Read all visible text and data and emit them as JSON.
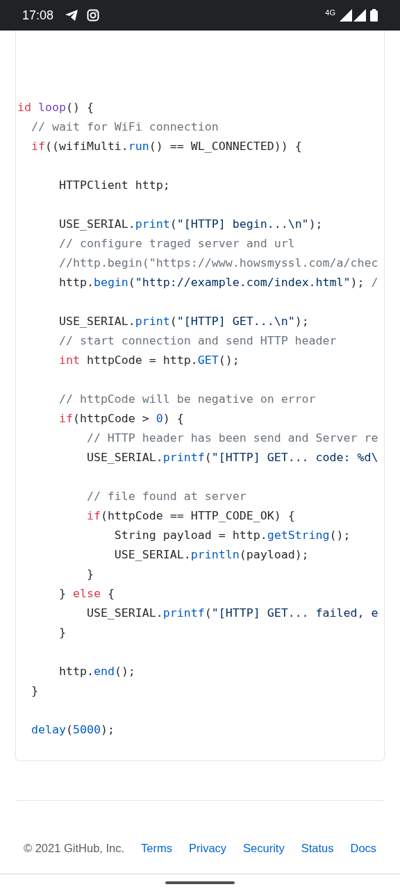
{
  "status_bar": {
    "time": "17:08",
    "network": "4G"
  },
  "code_lines": [
    {
      "kind": "blank"
    },
    {
      "kind": "blank"
    },
    {
      "kind": "blank"
    },
    {
      "kind": "blank"
    },
    {
      "kind": "code",
      "tokens": [
        {
          "text": "id",
          "kind": "keyword"
        },
        {
          "text": " loop",
          "kind": "entity"
        },
        {
          "text": "() {",
          "kind": "plain"
        }
      ]
    },
    {
      "kind": "code",
      "tokens": [
        {
          "text": "  // wait for WiFi connection",
          "kind": "comment"
        }
      ]
    },
    {
      "kind": "code",
      "tokens": [
        {
          "text": "  if",
          "kind": "keyword"
        },
        {
          "text": "((wifiMulti.",
          "kind": "plain"
        },
        {
          "text": "run",
          "kind": "function"
        },
        {
          "text": "() == WL_CONNECTED)) {",
          "kind": "plain"
        }
      ]
    },
    {
      "kind": "blank"
    },
    {
      "kind": "code",
      "tokens": [
        {
          "text": "      HTTPClient http;",
          "kind": "plain"
        }
      ]
    },
    {
      "kind": "blank"
    },
    {
      "kind": "code",
      "tokens": [
        {
          "text": "      USE_SERIAL.",
          "kind": "plain"
        },
        {
          "text": "print",
          "kind": "function"
        },
        {
          "text": "(",
          "kind": "plain"
        },
        {
          "text": "\"[HTTP] begin...\\n\"",
          "kind": "string"
        },
        {
          "text": ");",
          "kind": "plain"
        }
      ]
    },
    {
      "kind": "code",
      "tokens": [
        {
          "text": "      // configure traged server and url",
          "kind": "comment"
        }
      ]
    },
    {
      "kind": "code",
      "tokens": [
        {
          "text": "      //http.begin(\"https://www.howsmyssl.com/a/chec",
          "kind": "comment"
        }
      ]
    },
    {
      "kind": "code",
      "tokens": [
        {
          "text": "      http.",
          "kind": "plain"
        },
        {
          "text": "begin",
          "kind": "function"
        },
        {
          "text": "(",
          "kind": "plain"
        },
        {
          "text": "\"http://example.com/index.html\"",
          "kind": "string"
        },
        {
          "text": ");",
          "kind": "plain"
        },
        {
          "text": " /",
          "kind": "comment"
        }
      ]
    },
    {
      "kind": "blank"
    },
    {
      "kind": "code",
      "tokens": [
        {
          "text": "      USE_SERIAL.",
          "kind": "plain"
        },
        {
          "text": "print",
          "kind": "function"
        },
        {
          "text": "(",
          "kind": "plain"
        },
        {
          "text": "\"[HTTP] GET...\\n\"",
          "kind": "string"
        },
        {
          "text": ");",
          "kind": "plain"
        }
      ]
    },
    {
      "kind": "code",
      "tokens": [
        {
          "text": "      // start connection and send HTTP header",
          "kind": "comment"
        }
      ]
    },
    {
      "kind": "code",
      "tokens": [
        {
          "text": "      int",
          "kind": "keyword"
        },
        {
          "text": " httpCode = http.",
          "kind": "plain"
        },
        {
          "text": "GET",
          "kind": "function"
        },
        {
          "text": "();",
          "kind": "plain"
        }
      ]
    },
    {
      "kind": "blank"
    },
    {
      "kind": "code",
      "tokens": [
        {
          "text": "      // httpCode will be negative on error",
          "kind": "comment"
        }
      ]
    },
    {
      "kind": "code",
      "tokens": [
        {
          "text": "      if",
          "kind": "keyword"
        },
        {
          "text": "(httpCode > ",
          "kind": "plain"
        },
        {
          "text": "0",
          "kind": "function"
        },
        {
          "text": ") {",
          "kind": "plain"
        }
      ]
    },
    {
      "kind": "code",
      "tokens": [
        {
          "text": "          // HTTP header has been send and Server re",
          "kind": "comment"
        }
      ]
    },
    {
      "kind": "code",
      "tokens": [
        {
          "text": "          USE_SERIAL.",
          "kind": "plain"
        },
        {
          "text": "printf",
          "kind": "function"
        },
        {
          "text": "(",
          "kind": "plain"
        },
        {
          "text": "\"[HTTP] GET... code: %d\\",
          "kind": "string"
        }
      ]
    },
    {
      "kind": "blank"
    },
    {
      "kind": "code",
      "tokens": [
        {
          "text": "          // file found at server",
          "kind": "comment"
        }
      ]
    },
    {
      "kind": "code",
      "tokens": [
        {
          "text": "          if",
          "kind": "keyword"
        },
        {
          "text": "(httpCode == HTTP_CODE_OK) {",
          "kind": "plain"
        }
      ]
    },
    {
      "kind": "code",
      "tokens": [
        {
          "text": "              String payload = http.",
          "kind": "plain"
        },
        {
          "text": "getString",
          "kind": "function"
        },
        {
          "text": "();",
          "kind": "plain"
        }
      ]
    },
    {
      "kind": "code",
      "tokens": [
        {
          "text": "              USE_SERIAL.",
          "kind": "plain"
        },
        {
          "text": "println",
          "kind": "function"
        },
        {
          "text": "(payload);",
          "kind": "plain"
        }
      ]
    },
    {
      "kind": "code",
      "tokens": [
        {
          "text": "          }",
          "kind": "plain"
        }
      ]
    },
    {
      "kind": "code",
      "tokens": [
        {
          "text": "      } ",
          "kind": "plain"
        },
        {
          "text": "else",
          "kind": "keyword"
        },
        {
          "text": " {",
          "kind": "plain"
        }
      ]
    },
    {
      "kind": "code",
      "tokens": [
        {
          "text": "          USE_SERIAL.",
          "kind": "plain"
        },
        {
          "text": "printf",
          "kind": "function"
        },
        {
          "text": "(",
          "kind": "plain"
        },
        {
          "text": "\"[HTTP] GET... failed, e",
          "kind": "string"
        }
      ]
    },
    {
      "kind": "code",
      "tokens": [
        {
          "text": "      }",
          "kind": "plain"
        }
      ]
    },
    {
      "kind": "blank"
    },
    {
      "kind": "code",
      "tokens": [
        {
          "text": "      http.",
          "kind": "plain"
        },
        {
          "text": "end",
          "kind": "function"
        },
        {
          "text": "();",
          "kind": "plain"
        }
      ]
    },
    {
      "kind": "code",
      "tokens": [
        {
          "text": "  }",
          "kind": "plain"
        }
      ]
    },
    {
      "kind": "blank"
    },
    {
      "kind": "code",
      "tokens": [
        {
          "text": "  delay",
          "kind": "function"
        },
        {
          "text": "(",
          "kind": "plain"
        },
        {
          "text": "5000",
          "kind": "function"
        },
        {
          "text": ");",
          "kind": "plain"
        }
      ]
    }
  ],
  "footer": {
    "items": [
      {
        "text": "© 2021 GitHub, Inc.",
        "kind": "copyright"
      },
      {
        "text": "Terms",
        "kind": "link"
      },
      {
        "text": "Privacy",
        "kind": "link"
      },
      {
        "text": "Security",
        "kind": "link"
      },
      {
        "text": "Status",
        "kind": "link"
      },
      {
        "text": "Docs",
        "kind": "link"
      }
    ]
  }
}
